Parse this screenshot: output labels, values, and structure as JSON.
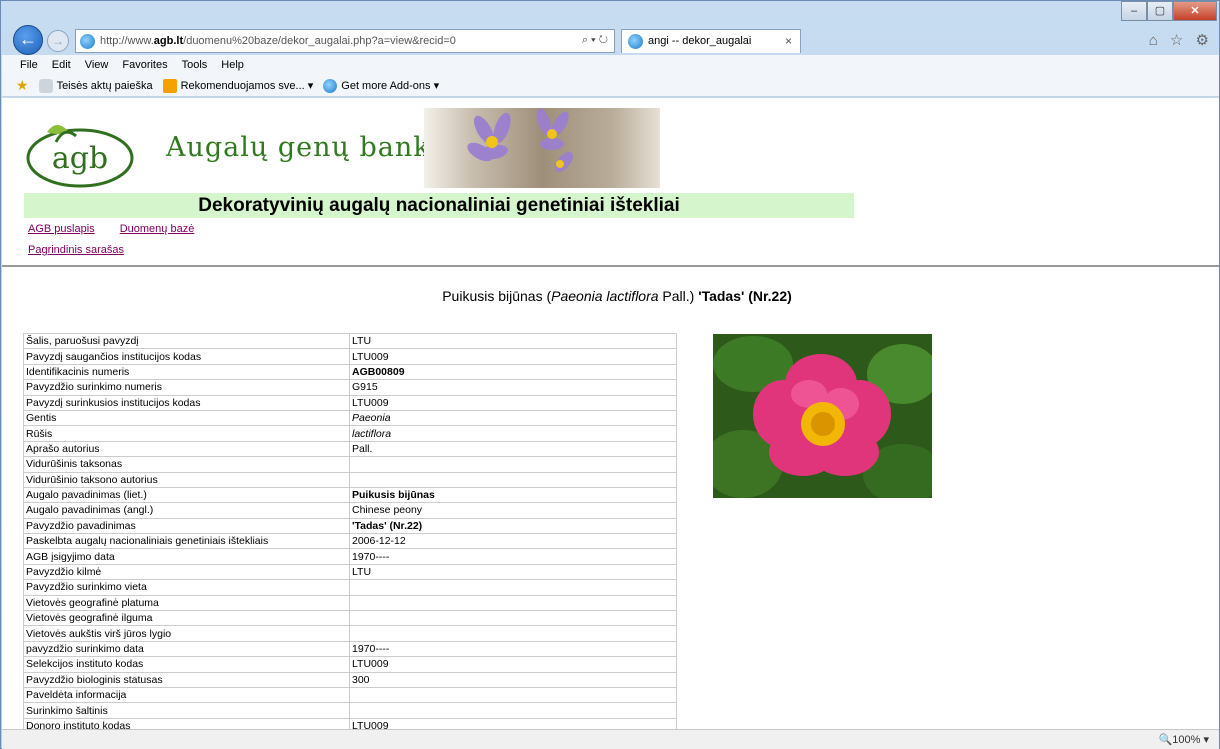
{
  "browser": {
    "url_prefix": "http://www.",
    "url_domain": "agb.lt",
    "url_rest": "/duomenu%20baze/dekor_augalai.php?a=view&recid=0",
    "addr_buttons": "⌕ ▾ ↻",
    "tab_title": "angi -- dekor_augalai",
    "tab_close": "×",
    "back_glyph": "←",
    "fwd_glyph": "→",
    "win_min": "–",
    "win_max": "▢",
    "win_close": "✕",
    "toolbar_icons": "⌂ ☆ ⚙"
  },
  "menu": [
    "File",
    "Edit",
    "View",
    "Favorites",
    "Tools",
    "Help"
  ],
  "favorites": [
    {
      "label": "Teisės aktų paieška",
      "icon": "grey-icon"
    },
    {
      "label": "Rekomenduojamos sve... ▾",
      "icon": "bing-icon"
    },
    {
      "label": "Get more Add-ons ▾",
      "icon": "ie-icon"
    }
  ],
  "page": {
    "banner_title": "Augalų genų bankas",
    "logo_text": "agb",
    "subheading": "Dekoratyvinių augalų nacionaliniai genetiniai ištekliai",
    "link_agb": "AGB puslapis",
    "link_db": "Duomenų bazė",
    "link_main": "Pagrindinis sarašas",
    "heading_pre": "Puikusis bijūnas (",
    "heading_latin": "Paeonia lactiflora",
    "heading_mid": " Pall.) ",
    "heading_bold": "'Tadas' (Nr.22)"
  },
  "rows": [
    {
      "k": "Šalis, paruošusi pavyzdį",
      "v": "LTU",
      "s": ""
    },
    {
      "k": "Pavyzdį saugančios institucijos kodas",
      "v": "LTU009",
      "s": ""
    },
    {
      "k": "Identifikacinis numeris",
      "v": "AGB00809",
      "s": "bold"
    },
    {
      "k": "Pavyzdžio surinkimo numeris",
      "v": "G915",
      "s": ""
    },
    {
      "k": "Pavyzdį surinkusios institucijos kodas",
      "v": "LTU009",
      "s": ""
    },
    {
      "k": "Gentis",
      "v": "Paeonia",
      "s": "ital"
    },
    {
      "k": "Rūšis",
      "v": "lactiflora",
      "s": "ital"
    },
    {
      "k": "Aprašo autorius",
      "v": "Pall.",
      "s": ""
    },
    {
      "k": "Vidurūšinis taksonas",
      "v": "",
      "s": ""
    },
    {
      "k": "Vidurūšinio taksono autorius",
      "v": "",
      "s": ""
    },
    {
      "k": "Augalo pavadinimas (liet.)",
      "v": "Puikusis bijūnas",
      "s": "bold"
    },
    {
      "k": "Augalo pavadinimas (angl.)",
      "v": "Chinese peony",
      "s": ""
    },
    {
      "k": "Pavyzdžio pavadinimas",
      "v": "'Tadas' (Nr.22)",
      "s": "bold"
    },
    {
      "k": "Paskelbta augalų nacionaliniais genetiniais ištekliais",
      "v": "2006-12-12",
      "s": ""
    },
    {
      "k": "AGB įsigyjimo data",
      "v": "1970----",
      "s": ""
    },
    {
      "k": "Pavyzdžio kilmė",
      "v": "LTU",
      "s": ""
    },
    {
      "k": "Pavyzdžio surinkimo vieta",
      "v": "",
      "s": ""
    },
    {
      "k": "Vietovės geografinė platuma",
      "v": "",
      "s": ""
    },
    {
      "k": "Vietovės geografinė ilguma",
      "v": "",
      "s": ""
    },
    {
      "k": "Vietovės aukštis virš jūros lygio",
      "v": "",
      "s": ""
    },
    {
      "k": "pavyzdžio surinkimo data",
      "v": "1970----",
      "s": ""
    },
    {
      "k": "Selekcijos instituto kodas",
      "v": "LTU009",
      "s": ""
    },
    {
      "k": "Pavyzdžio biologinis statusas",
      "v": "300",
      "s": ""
    },
    {
      "k": "Paveldėta informacija",
      "v": "",
      "s": ""
    },
    {
      "k": "Surinkimo šaltinis",
      "v": "",
      "s": ""
    },
    {
      "k": "Donoro instituto kodas",
      "v": "LTU009",
      "s": ""
    }
  ],
  "status": {
    "zoom": "🔍100% ▾"
  }
}
